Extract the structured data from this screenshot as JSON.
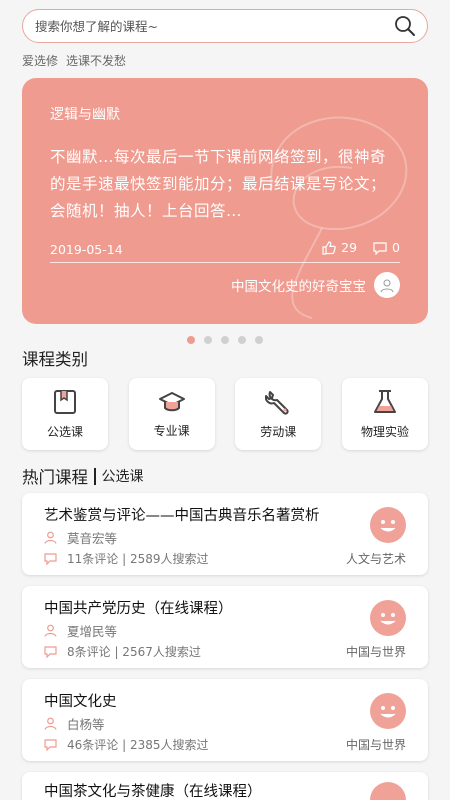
{
  "search": {
    "placeholder": "搜索你想了解的课程~"
  },
  "slogan": [
    "爱选修",
    "选课不发愁"
  ],
  "banner": {
    "title": "逻辑与幽默",
    "text": "不幽默…每次最后一节下课前网络签到，很神奇的是手速最快签到能加分；最后结课是写论文；会随机！抽人！上台回答…",
    "date": "2019-05-14",
    "likes": "29",
    "comments": "0",
    "author": "中国文化史的好奇宝宝",
    "color": "#ef9b90"
  },
  "carousel": {
    "count": 5,
    "active": 0
  },
  "categories_title": "课程类别",
  "categories": [
    {
      "label": "公选课",
      "icon": "book-icon"
    },
    {
      "label": "专业课",
      "icon": "graduation-cap-icon"
    },
    {
      "label": "劳动课",
      "icon": "wrench-icon"
    },
    {
      "label": "物理实验",
      "icon": "flask-icon"
    }
  ],
  "hot": {
    "title": "热门课程",
    "sub": "公选课"
  },
  "courses": [
    {
      "name": "艺术鉴赏与评论——中国古典音乐名著赏析",
      "teacher": "莫音宏等",
      "meta": "11条评论 | 2589人搜索过",
      "tag": "人文与艺术"
    },
    {
      "name": "中国共产党历史（在线课程）",
      "teacher": "夏增民等",
      "meta": "8条评论 | 2567人搜索过",
      "tag": "中国与世界"
    },
    {
      "name": "中国文化史",
      "teacher": "白杨等",
      "meta": "46条评论 | 2385人搜索过",
      "tag": "中国与世界"
    },
    {
      "name": "中国茶文化与茶健康（在线课程）",
      "teacher": "",
      "meta": "",
      "tag": ""
    }
  ],
  "accent_color": "#ef9b90"
}
